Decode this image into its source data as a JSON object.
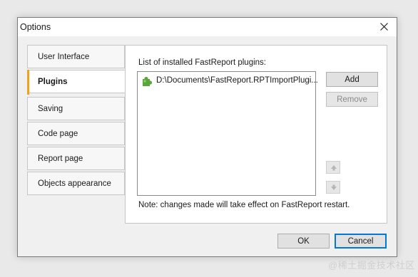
{
  "window": {
    "title": "Options"
  },
  "tabs": [
    {
      "label": "User Interface",
      "active": false
    },
    {
      "label": "Plugins",
      "active": true
    },
    {
      "label": "Saving",
      "active": false
    },
    {
      "label": "Code page",
      "active": false
    },
    {
      "label": "Report page",
      "active": false
    },
    {
      "label": "Objects appearance",
      "active": false
    }
  ],
  "plugins_panel": {
    "list_label": "List of installed FastReport plugins:",
    "items": [
      {
        "icon": "puzzle-piece-icon",
        "text": "D:\\Documents\\FastReport.RPTImportPlugi..."
      }
    ],
    "add_label": "Add",
    "remove_label": "Remove",
    "note": "Note: changes made will take effect on FastReport restart."
  },
  "footer": {
    "ok_label": "OK",
    "cancel_label": "Cancel"
  },
  "watermark": "@稀土掘金技术社区",
  "colors": {
    "accent": "#f0a21a",
    "default_button": "#0078d7",
    "plugin_icon": "#5aa63a"
  }
}
